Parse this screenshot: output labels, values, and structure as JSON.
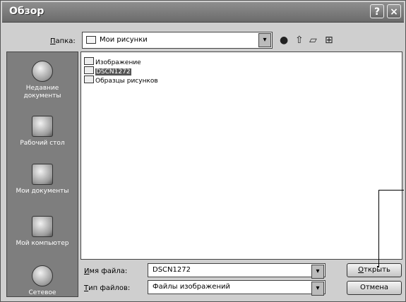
{
  "window": {
    "title": "Обзор"
  },
  "toolbar": {
    "lookin_label_prefix": "П",
    "lookin_label_rest": "апка:",
    "lookin_value": "Мои рисунки"
  },
  "places": [
    {
      "label": "Недавние документы"
    },
    {
      "label": "Рабочий стол"
    },
    {
      "label": "Мои документы"
    },
    {
      "label": "Мой компьютер"
    },
    {
      "label": "Сетевое"
    }
  ],
  "files": [
    {
      "name": "Изображение"
    },
    {
      "name": "DSCN1272"
    },
    {
      "name": "Образцы рисунков"
    }
  ],
  "fields": {
    "filename_label_prefix": "И",
    "filename_label_rest": "мя файла:",
    "filename_value": "DSCN1272",
    "filetype_label_prefix": "Т",
    "filetype_label_rest": "ип файлов:",
    "filetype_value": "Файлы изображений"
  },
  "buttons": {
    "open_prefix": "О",
    "open_rest": "ткрыть",
    "cancel": "Отмена"
  },
  "icons": {
    "help": "?",
    "close": "×"
  }
}
